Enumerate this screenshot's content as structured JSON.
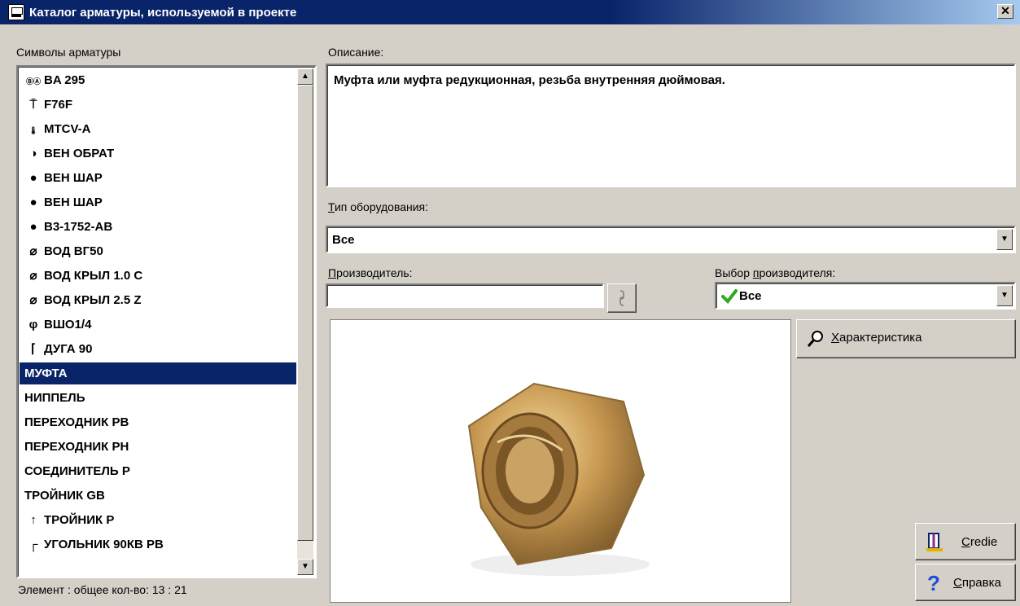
{
  "window": {
    "title": "Каталог арматуры, используемой в проекте",
    "close_label": "✕"
  },
  "symbols_panel": {
    "label": "Символы арматуры",
    "items": [
      {
        "icon": "ba-circle-icon",
        "glyph": "ⒷⒶ",
        "label": "BA 295"
      },
      {
        "icon": "valve-t-icon",
        "glyph": "⍑",
        "label": "F76F"
      },
      {
        "icon": "thermostat-icon",
        "glyph": "🌡",
        "label": "MTCV-A"
      },
      {
        "icon": "check-valve-icon",
        "glyph": "◑",
        "label": "ВЕН ОБРАТ"
      },
      {
        "icon": "ball-valve-icon",
        "glyph": "●",
        "label": "ВЕН ШАР"
      },
      {
        "icon": "ball-valve-icon",
        "glyph": "●",
        "label": "ВЕН ШАР"
      },
      {
        "icon": "ball-valve-handle-icon",
        "glyph": "●",
        "label": "В3-1752-АВ"
      },
      {
        "icon": "water-meter-icon",
        "glyph": "⌀",
        "label": "ВОД ВГ50"
      },
      {
        "icon": "water-meter-icon",
        "glyph": "⌀",
        "label": "ВОД КРЫЛ 1.0 С"
      },
      {
        "icon": "water-meter-icon",
        "glyph": "⌀",
        "label": "ВОД КРЫЛ 2.5 Z"
      },
      {
        "icon": "fitting-icon",
        "glyph": "φ",
        "label": "ВШО1/4"
      },
      {
        "icon": "elbow-icon",
        "glyph": "⌈",
        "label": "ДУГА 90"
      },
      {
        "icon": "",
        "glyph": "",
        "label": "МУФТА"
      },
      {
        "icon": "",
        "glyph": "",
        "label": "НИППЕЛЬ"
      },
      {
        "icon": "",
        "glyph": "",
        "label": "ПЕРЕХОДНИК РВ"
      },
      {
        "icon": "",
        "glyph": "",
        "label": "ПЕРЕХОДНИК РН"
      },
      {
        "icon": "",
        "glyph": "",
        "label": "СОЕДИНИТЕЛЬ Р"
      },
      {
        "icon": "",
        "glyph": "",
        "label": "ТРОЙНИК GB"
      },
      {
        "icon": "tee-icon",
        "glyph": "↑",
        "label": "ТРОЙНИК Р"
      },
      {
        "icon": "angle-icon",
        "glyph": "┌",
        "label": "УГОЛЬНИК 90КВ РВ"
      }
    ],
    "selected_index": 12,
    "status": "Элемент : общее кол-во: 13 : 21"
  },
  "description": {
    "label": "Описание:",
    "text": "Муфта или муфта редукционная, резьба внутренняя дюймовая."
  },
  "equipment_type": {
    "label_underlined": "Т",
    "label_rest": "ип обору",
    "label_u2": "д",
    "label_end": "ования:",
    "value": "Все"
  },
  "manufacturer": {
    "label_u": "П",
    "label_rest": "роизводитель:",
    "value": ""
  },
  "manufacturer_choice": {
    "label_a": "Выбор ",
    "label_u": "п",
    "label_b": "роизводителя:",
    "value": "Все"
  },
  "buttons": {
    "characteristics": {
      "u": "Х",
      "rest": "арактеристика"
    },
    "credie": {
      "u": "C",
      "rest": "redie"
    },
    "help": {
      "u": "С",
      "rest": "правка"
    }
  },
  "colors": {
    "selection": "#0a246a",
    "check": "#2fa81f",
    "help_icon": "#1a4fd6"
  }
}
